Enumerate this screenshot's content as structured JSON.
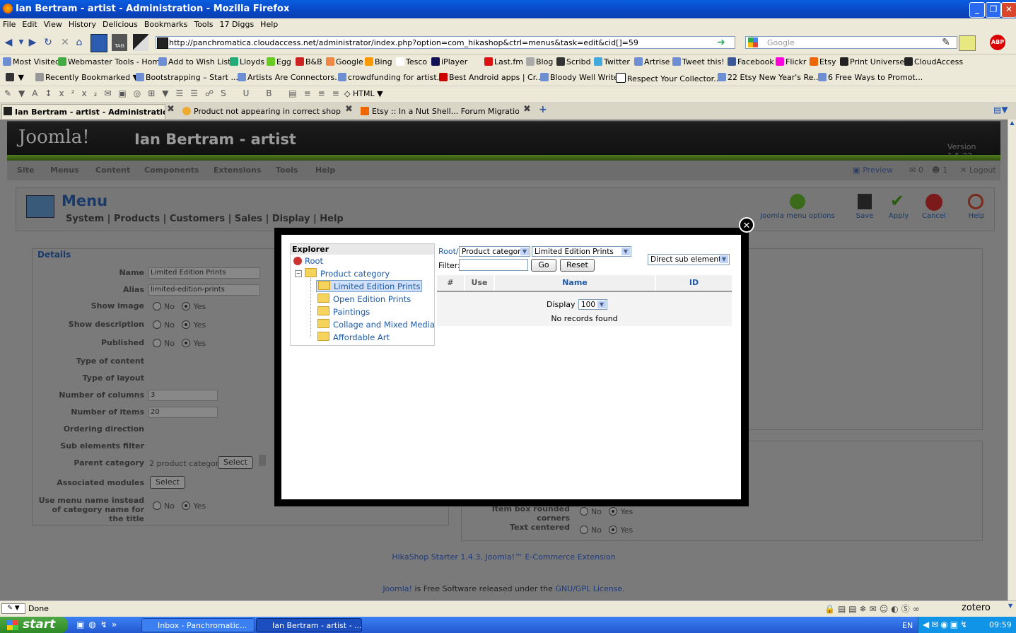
{
  "window": {
    "title": "Ian Bertram - artist - Administration - Mozilla Firefox"
  },
  "menubar": [
    "File",
    "Edit",
    "View",
    "History",
    "Delicious",
    "Bookmarks",
    "Tools",
    "17 Diggs",
    "Help"
  ],
  "navbar": {
    "url": "http://panchromatica.cloudaccess.net/administrator/index.php?option=com_hikashop&ctrl=menus&task=edit&cid[]=59",
    "search_placeholder": "Google",
    "tag_label": "TAG"
  },
  "bookmarks1": [
    "Most Visited",
    "Webmaster Tools - Home",
    "Add to Wish List",
    "Lloyds",
    "Egg",
    "B&B",
    "Google",
    "Bing",
    "Tesco",
    "iPlayer",
    "Last.fm",
    "Blog",
    "Scribd",
    "Twitter",
    "Artrise",
    "Tweet this!",
    "Facebook",
    "Flickr",
    "Etsy",
    "Print Universe",
    "CloudAccess"
  ],
  "bookmarks2": [
    "Recently Bookmarked",
    "Bootstrapping – Start ...",
    "Artists Are Connectors...",
    "crowdfunding for artist...",
    "Best Android apps | Cr...",
    "Bloody Well Write",
    "Respect Your Collector...",
    "22 Etsy New Year's Re...",
    "6 Free Ways to Promot..."
  ],
  "formatbar": {
    "html_label": "HTML"
  },
  "tabs": [
    "Ian Bertram - artist - Administration",
    "Product not appearing in correct shop cat...",
    "Etsy :: In a Nut Shell... Forum Migration..."
  ],
  "joomla": {
    "logo": "Joomla!",
    "site_name": "Ian Bertram - artist",
    "version": "Version 1.5.22",
    "menu": [
      "Site",
      "Menus",
      "Content",
      "Components",
      "Extensions",
      "Tools",
      "Help"
    ],
    "preview": "Preview",
    "count1": "0",
    "count2": "1",
    "logout": "Logout",
    "page_title": "Menu",
    "submenu": [
      "System",
      "Products",
      "Customers",
      "Sales",
      "Display",
      "Help"
    ],
    "toolbar": [
      "Joomla menu options",
      "Save",
      "Apply",
      "Cancel",
      "Help"
    ]
  },
  "details": {
    "legend": "Details",
    "fields": [
      {
        "label": "Name",
        "value": "Limited Edition Prints"
      },
      {
        "label": "Alias",
        "value": "limited-edition-prints"
      },
      {
        "label": "Show image"
      },
      {
        "label": "Show description"
      },
      {
        "label": "Published"
      },
      {
        "label": "Type of content"
      },
      {
        "label": "Type of layout"
      },
      {
        "label": "Number of columns",
        "value": "3"
      },
      {
        "label": "Number of items",
        "value": "20"
      },
      {
        "label": "Ordering direction"
      },
      {
        "label": "Sub elements filter"
      },
      {
        "label": "Parent category",
        "value": "2 product category",
        "button": "Select"
      },
      {
        "label": "Associated modules",
        "button": "Select"
      },
      {
        "label": "Use menu name instead of category name for the title"
      }
    ],
    "no": "No",
    "yes": "Yes"
  },
  "right_panel": [
    {
      "label": "Item box rounded corners"
    },
    {
      "label": "Text centered"
    }
  ],
  "footer": {
    "hikashop": "HikaShop Starter 1.4.3, Joomla!™ E-Commerce Extension",
    "joomla_link": "Joomla!",
    "free_text": "is Free Software released under the",
    "license_link": "GNU/GPL License."
  },
  "modal": {
    "explorer_title": "Explorer",
    "root": "Root",
    "product_category": "Product category",
    "children": [
      "Limited Edition Prints",
      "Open Edition Prints",
      "Paintings",
      "Collage and Mixed Media",
      "Affordable Art"
    ],
    "breadcrumb_root": "Root/",
    "type_select": "Product category",
    "category_select": "Limited Edition Prints",
    "filter_label": "Filter:",
    "go": "Go",
    "reset": "Reset",
    "scope_select": "Direct sub elements",
    "columns": [
      "#",
      "Use",
      "Name",
      "ID"
    ],
    "display_label": "Display #",
    "display_value": "100",
    "empty": "No records found"
  },
  "status": {
    "text": "Done",
    "zotero": "zotero"
  },
  "taskbar": {
    "start": "start",
    "items": [
      "Inbox - Panchromatic...",
      "Ian Bertram - artist - ..."
    ],
    "lang": "EN",
    "clock": "09:59"
  }
}
